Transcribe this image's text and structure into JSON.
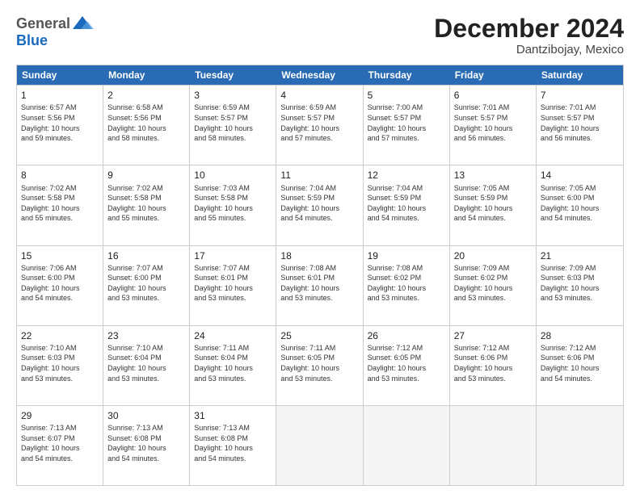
{
  "logo": {
    "general": "General",
    "blue": "Blue"
  },
  "title": "December 2024",
  "subtitle": "Dantzibojay, Mexico",
  "days": [
    "Sunday",
    "Monday",
    "Tuesday",
    "Wednesday",
    "Thursday",
    "Friday",
    "Saturday"
  ],
  "weeks": [
    [
      {
        "day": "1",
        "lines": [
          "Sunrise: 6:57 AM",
          "Sunset: 5:56 PM",
          "Daylight: 10 hours",
          "and 59 minutes."
        ]
      },
      {
        "day": "2",
        "lines": [
          "Sunrise: 6:58 AM",
          "Sunset: 5:56 PM",
          "Daylight: 10 hours",
          "and 58 minutes."
        ]
      },
      {
        "day": "3",
        "lines": [
          "Sunrise: 6:59 AM",
          "Sunset: 5:57 PM",
          "Daylight: 10 hours",
          "and 58 minutes."
        ]
      },
      {
        "day": "4",
        "lines": [
          "Sunrise: 6:59 AM",
          "Sunset: 5:57 PM",
          "Daylight: 10 hours",
          "and 57 minutes."
        ]
      },
      {
        "day": "5",
        "lines": [
          "Sunrise: 7:00 AM",
          "Sunset: 5:57 PM",
          "Daylight: 10 hours",
          "and 57 minutes."
        ]
      },
      {
        "day": "6",
        "lines": [
          "Sunrise: 7:01 AM",
          "Sunset: 5:57 PM",
          "Daylight: 10 hours",
          "and 56 minutes."
        ]
      },
      {
        "day": "7",
        "lines": [
          "Sunrise: 7:01 AM",
          "Sunset: 5:57 PM",
          "Daylight: 10 hours",
          "and 56 minutes."
        ]
      }
    ],
    [
      {
        "day": "8",
        "lines": [
          "Sunrise: 7:02 AM",
          "Sunset: 5:58 PM",
          "Daylight: 10 hours",
          "and 55 minutes."
        ]
      },
      {
        "day": "9",
        "lines": [
          "Sunrise: 7:02 AM",
          "Sunset: 5:58 PM",
          "Daylight: 10 hours",
          "and 55 minutes."
        ]
      },
      {
        "day": "10",
        "lines": [
          "Sunrise: 7:03 AM",
          "Sunset: 5:58 PM",
          "Daylight: 10 hours",
          "and 55 minutes."
        ]
      },
      {
        "day": "11",
        "lines": [
          "Sunrise: 7:04 AM",
          "Sunset: 5:59 PM",
          "Daylight: 10 hours",
          "and 54 minutes."
        ]
      },
      {
        "day": "12",
        "lines": [
          "Sunrise: 7:04 AM",
          "Sunset: 5:59 PM",
          "Daylight: 10 hours",
          "and 54 minutes."
        ]
      },
      {
        "day": "13",
        "lines": [
          "Sunrise: 7:05 AM",
          "Sunset: 5:59 PM",
          "Daylight: 10 hours",
          "and 54 minutes."
        ]
      },
      {
        "day": "14",
        "lines": [
          "Sunrise: 7:05 AM",
          "Sunset: 6:00 PM",
          "Daylight: 10 hours",
          "and 54 minutes."
        ]
      }
    ],
    [
      {
        "day": "15",
        "lines": [
          "Sunrise: 7:06 AM",
          "Sunset: 6:00 PM",
          "Daylight: 10 hours",
          "and 54 minutes."
        ]
      },
      {
        "day": "16",
        "lines": [
          "Sunrise: 7:07 AM",
          "Sunset: 6:00 PM",
          "Daylight: 10 hours",
          "and 53 minutes."
        ]
      },
      {
        "day": "17",
        "lines": [
          "Sunrise: 7:07 AM",
          "Sunset: 6:01 PM",
          "Daylight: 10 hours",
          "and 53 minutes."
        ]
      },
      {
        "day": "18",
        "lines": [
          "Sunrise: 7:08 AM",
          "Sunset: 6:01 PM",
          "Daylight: 10 hours",
          "and 53 minutes."
        ]
      },
      {
        "day": "19",
        "lines": [
          "Sunrise: 7:08 AM",
          "Sunset: 6:02 PM",
          "Daylight: 10 hours",
          "and 53 minutes."
        ]
      },
      {
        "day": "20",
        "lines": [
          "Sunrise: 7:09 AM",
          "Sunset: 6:02 PM",
          "Daylight: 10 hours",
          "and 53 minutes."
        ]
      },
      {
        "day": "21",
        "lines": [
          "Sunrise: 7:09 AM",
          "Sunset: 6:03 PM",
          "Daylight: 10 hours",
          "and 53 minutes."
        ]
      }
    ],
    [
      {
        "day": "22",
        "lines": [
          "Sunrise: 7:10 AM",
          "Sunset: 6:03 PM",
          "Daylight: 10 hours",
          "and 53 minutes."
        ]
      },
      {
        "day": "23",
        "lines": [
          "Sunrise: 7:10 AM",
          "Sunset: 6:04 PM",
          "Daylight: 10 hours",
          "and 53 minutes."
        ]
      },
      {
        "day": "24",
        "lines": [
          "Sunrise: 7:11 AM",
          "Sunset: 6:04 PM",
          "Daylight: 10 hours",
          "and 53 minutes."
        ]
      },
      {
        "day": "25",
        "lines": [
          "Sunrise: 7:11 AM",
          "Sunset: 6:05 PM",
          "Daylight: 10 hours",
          "and 53 minutes."
        ]
      },
      {
        "day": "26",
        "lines": [
          "Sunrise: 7:12 AM",
          "Sunset: 6:05 PM",
          "Daylight: 10 hours",
          "and 53 minutes."
        ]
      },
      {
        "day": "27",
        "lines": [
          "Sunrise: 7:12 AM",
          "Sunset: 6:06 PM",
          "Daylight: 10 hours",
          "and 53 minutes."
        ]
      },
      {
        "day": "28",
        "lines": [
          "Sunrise: 7:12 AM",
          "Sunset: 6:06 PM",
          "Daylight: 10 hours",
          "and 54 minutes."
        ]
      }
    ],
    [
      {
        "day": "29",
        "lines": [
          "Sunrise: 7:13 AM",
          "Sunset: 6:07 PM",
          "Daylight: 10 hours",
          "and 54 minutes."
        ]
      },
      {
        "day": "30",
        "lines": [
          "Sunrise: 7:13 AM",
          "Sunset: 6:08 PM",
          "Daylight: 10 hours",
          "and 54 minutes."
        ]
      },
      {
        "day": "31",
        "lines": [
          "Sunrise: 7:13 AM",
          "Sunset: 6:08 PM",
          "Daylight: 10 hours",
          "and 54 minutes."
        ]
      },
      {
        "day": "",
        "lines": []
      },
      {
        "day": "",
        "lines": []
      },
      {
        "day": "",
        "lines": []
      },
      {
        "day": "",
        "lines": []
      }
    ]
  ]
}
